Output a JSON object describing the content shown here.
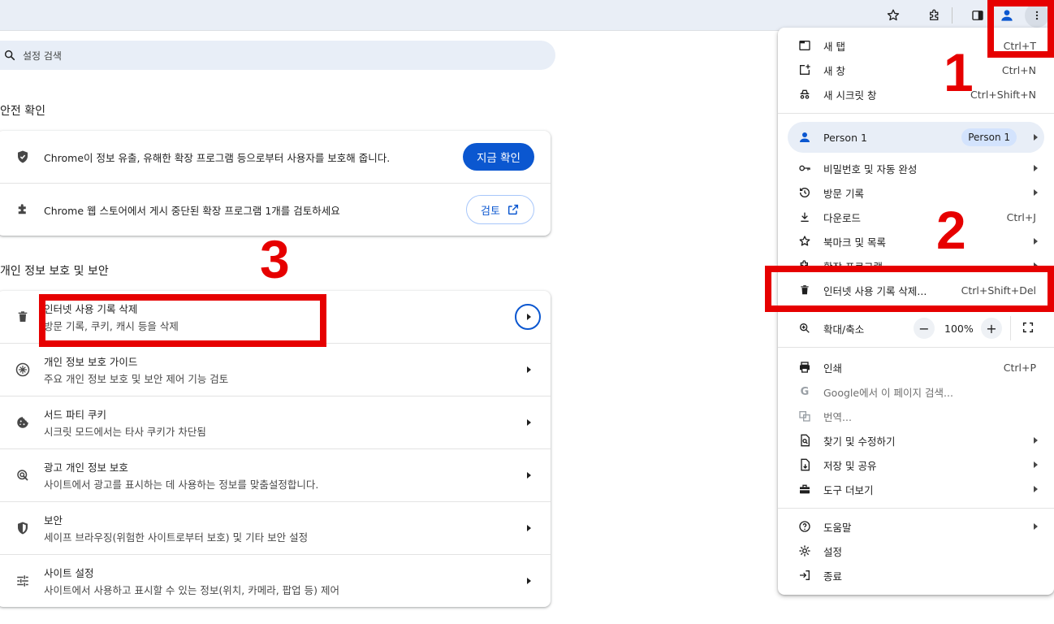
{
  "settings": {
    "search_placeholder": "설정 검색",
    "safety": {
      "title": "안전 확인",
      "rows": [
        {
          "text": "Chrome이 정보 유출, 유해한 확장 프로그램 등으로부터 사용자를 보호해 줍니다.",
          "button": "지금 확인"
        },
        {
          "text": "Chrome 웹 스토어에서 게시 중단된 확장 프로그램 1개를 검토하세요",
          "button": "검토"
        }
      ]
    },
    "privacy": {
      "title": "개인 정보 보호 및 보안",
      "rows": [
        {
          "title": "인터넷 사용 기록 삭제",
          "sub": "방문 기록, 쿠키, 캐시 등을 삭제"
        },
        {
          "title": "개인 정보 보호 가이드",
          "sub": "주요 개인 정보 보호 및 보안 제어 기능 검토"
        },
        {
          "title": "서드 파티 쿠키",
          "sub": "시크릿 모드에서는 타사 쿠키가 차단됨"
        },
        {
          "title": "광고 개인 정보 보호",
          "sub": "사이트에서 광고를 표시하는 데 사용하는 정보를 맞춤설정합니다."
        },
        {
          "title": "보안",
          "sub": "세이프 브라우징(위험한 사이트로부터 보호) 및 기타 보안 설정"
        },
        {
          "title": "사이트 설정",
          "sub": "사이트에서 사용하고 표시할 수 있는 정보(위치, 카메라, 팝업 등) 제어"
        }
      ]
    }
  },
  "menu": {
    "new_tab": {
      "label": "새 탭",
      "shortcut": "Ctrl+T"
    },
    "new_window": {
      "label": "새 창",
      "shortcut": "Ctrl+N"
    },
    "new_incognito": {
      "label": "새 시크릿 창",
      "shortcut": "Ctrl+Shift+N"
    },
    "person": {
      "label": "Person 1",
      "badge": "Person 1"
    },
    "passwords": {
      "label": "비밀번호 및 자동 완성"
    },
    "history": {
      "label": "방문 기록"
    },
    "downloads": {
      "label": "다운로드",
      "shortcut": "Ctrl+J"
    },
    "bookmarks": {
      "label": "북마크 및 목록"
    },
    "extensions": {
      "label": "확장 프로그램"
    },
    "clear_data": {
      "label": "인터넷 사용 기록 삭제...",
      "shortcut": "Ctrl+Shift+Del"
    },
    "zoom": {
      "label": "확대/축소",
      "value": "100%"
    },
    "print": {
      "label": "인쇄",
      "shortcut": "Ctrl+P"
    },
    "google_search": {
      "label": "Google에서 이 페이지 검색..."
    },
    "translate": {
      "label": "번역..."
    },
    "find_edit": {
      "label": "찾기 및 수정하기"
    },
    "save_share": {
      "label": "저장 및 공유"
    },
    "more_tools": {
      "label": "도구 더보기"
    },
    "help": {
      "label": "도움말"
    },
    "settings": {
      "label": "설정"
    },
    "exit": {
      "label": "종료"
    }
  },
  "annotations": {
    "n1": "1",
    "n2": "2",
    "n3": "3",
    "color": "#e60000"
  }
}
